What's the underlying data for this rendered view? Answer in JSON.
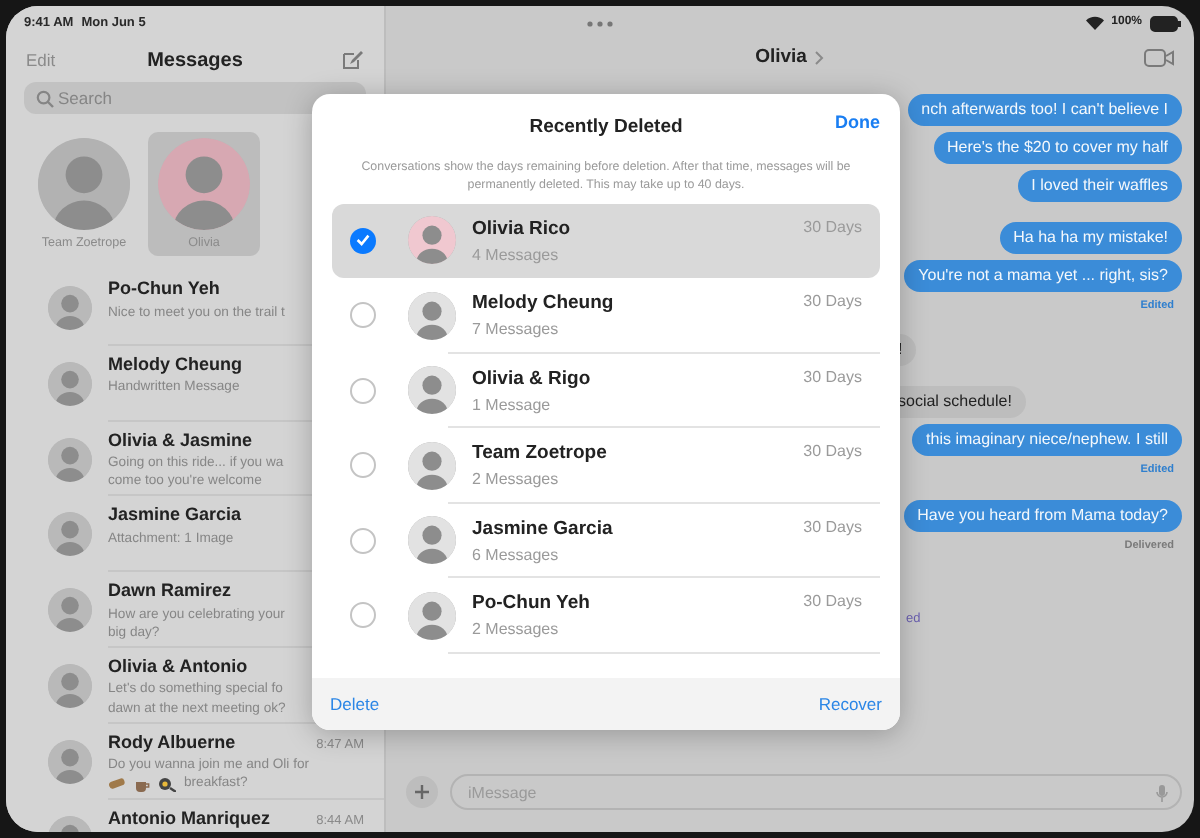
{
  "status_bar": {
    "time": "9:41 AM",
    "date": "Mon Jun 5",
    "battery": "100%"
  },
  "sidebar": {
    "edit": "Edit",
    "title": "Messages",
    "search": {
      "placeholder": "Search"
    },
    "pinned": [
      {
        "name": "Team Zoetrope",
        "selected": false
      },
      {
        "name": "Olivia",
        "selected": true
      }
    ],
    "conversations": [
      {
        "name": "Po-Chun Yeh",
        "preview": [
          "Nice to meet you on the trail t"
        ]
      },
      {
        "name": "Melody Cheung",
        "preview": [
          "Handwritten Message"
        ]
      },
      {
        "name": "Olivia & Jasmine",
        "preview": [
          "Going on this ride... if you wa",
          "come too you're welcome"
        ]
      },
      {
        "name": "Jasmine Garcia",
        "preview": [
          "Attachment: 1 Image"
        ]
      },
      {
        "name": "Dawn Ramirez",
        "preview": [
          "How are you celebrating your",
          "big day?"
        ]
      },
      {
        "name": "Olivia & Antonio",
        "preview": [
          "Let's do something special fo",
          "dawn at the next meeting ok?"
        ]
      },
      {
        "name": "Rody Albuerne",
        "time": "8:47 AM",
        "preview": [
          "Do you wanna join me and Oli for",
          "breakfast?"
        ],
        "food_icons": true
      },
      {
        "name": "Antonio Manriquez",
        "time": "8:44 AM"
      }
    ]
  },
  "chat": {
    "title": "Olivia",
    "groups": [
      {
        "messages": [
          {
            "kind": "sent",
            "text": "nch afterwards too! I can't believe I"
          },
          {
            "kind": "sent",
            "text": "Here's the $20 to cover my half"
          },
          {
            "kind": "sent",
            "text": "I loved their waffles"
          }
        ]
      },
      {
        "messages": [
          {
            "kind": "sent",
            "text": "Ha ha ha my mistake!"
          },
          {
            "kind": "sent",
            "text": "You're not a mama yet ... right, sis?"
          }
        ],
        "note": {
          "kind": "edited",
          "text": "Edited"
        }
      },
      {
        "messages": [
          {
            "kind": "received",
            "text": "!"
          }
        ]
      },
      {
        "messages": [
          {
            "kind": "received",
            "text": "social schedule!"
          },
          {
            "kind": "sent",
            "text": "this imaginary niece/nephew. I still"
          }
        ],
        "note": {
          "kind": "edited",
          "text": "Edited"
        }
      },
      {
        "messages": [
          {
            "kind": "sent",
            "text": "Have you heard from Mama today?"
          }
        ],
        "note": {
          "kind": "delivered",
          "text": "Delivered"
        }
      }
    ],
    "notice": "ed",
    "input": {
      "placeholder": "iMessage"
    }
  },
  "dialog": {
    "title": "Recently Deleted",
    "done": "Done",
    "description": "Conversations show the days remaining before deletion. After that time, messages will be permanently deleted. This may take up to 40 days.",
    "items": [
      {
        "name": "Olivia Rico",
        "count": "4 Messages",
        "days": "30 Days",
        "selected": true
      },
      {
        "name": "Melody Cheung",
        "count": "7 Messages",
        "days": "30 Days",
        "selected": false
      },
      {
        "name": "Olivia & Rigo",
        "count": "1 Message",
        "days": "30 Days",
        "selected": false
      },
      {
        "name": "Team Zoetrope",
        "count": "2 Messages",
        "days": "30 Days",
        "selected": false
      },
      {
        "name": "Jasmine Garcia",
        "count": "6 Messages",
        "days": "30 Days",
        "selected": false
      },
      {
        "name": "Po-Chun Yeh",
        "count": "2 Messages",
        "days": "30 Days",
        "selected": false
      }
    ],
    "delete": "Delete",
    "recover": "Recover"
  }
}
